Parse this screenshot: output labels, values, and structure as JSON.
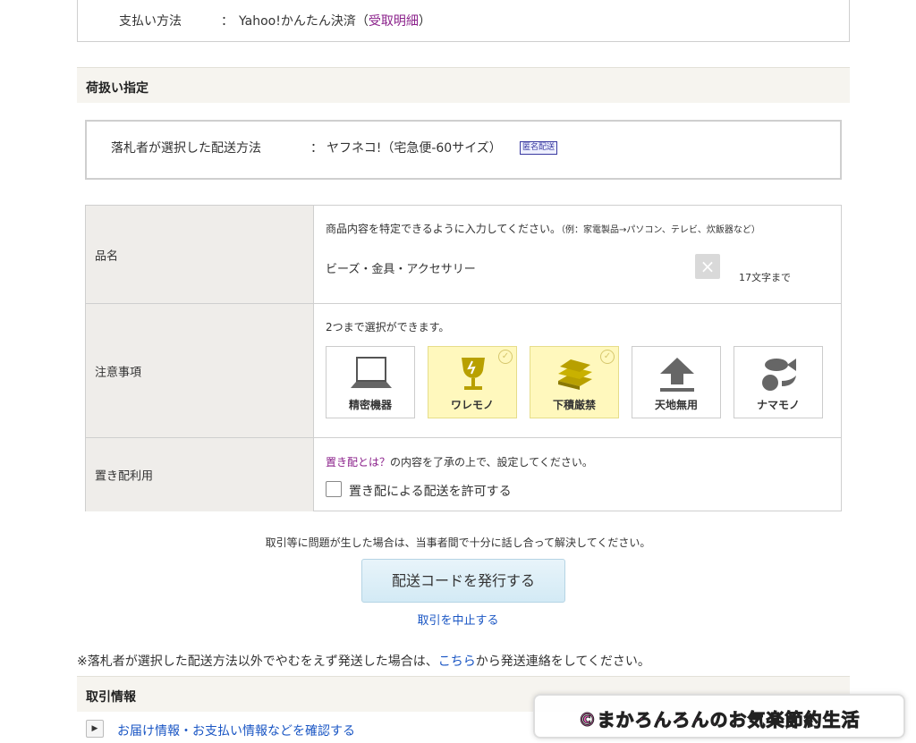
{
  "payment": {
    "label": "支払い方法",
    "colon": "：",
    "value": "Yahoo!かんたん決済",
    "paren_open": "（",
    "receipt_link": "受取明細",
    "paren_close": "）"
  },
  "handling_section": {
    "title": "荷扱い指定"
  },
  "shipping": {
    "label": "落札者が選択した配送方法",
    "colon": "：",
    "value": "ヤフネコ!（宅急便-60サイズ）",
    "badge": "匿名配送"
  },
  "item_name": {
    "header": "品名",
    "hint": "商品内容を特定できるように入力してください。",
    "example": "（例：家電製品→パソコン、テレビ、炊飯器など）",
    "value": "ビーズ・金具・アクセサリー",
    "clear_icon": "×",
    "max_length": "17文字まで"
  },
  "caution": {
    "header": "注意事項",
    "hint": "2つまで選択ができます。",
    "check_icon": "✓",
    "options": [
      {
        "label": "精密機器",
        "icon": "laptop-icon",
        "selected": false
      },
      {
        "label": "ワレモノ",
        "icon": "broken-glass-icon",
        "selected": true
      },
      {
        "label": "下積厳禁",
        "icon": "stacked-books-icon",
        "selected": true
      },
      {
        "label": "天地無用",
        "icon": "up-arrow-icon",
        "selected": false
      },
      {
        "label": "ナマモノ",
        "icon": "perishables-icon",
        "selected": false
      }
    ]
  },
  "okihai": {
    "header": "置き配利用",
    "hint_link": "置き配とは？",
    "hint_rest": "の内容を了承の上で、設定してください。",
    "checkbox_label": "置き配による配送を許可する",
    "checked": false
  },
  "notice": "取引等に問題が生した場合は、当事者間で十分に話し合って解決してください。",
  "issue_button": "配送コードを発行する",
  "cancel_link": "取引を中止する",
  "footnote": {
    "prefix": "※落札者が選択した配送方法以外でやむをえず発送した場合は、",
    "link": "こちら",
    "suffix": "から発送連絡をしてください。"
  },
  "trade_section": {
    "title": "取引情報"
  },
  "detail": {
    "play_icon": "▶",
    "link": "お届け情報・お支払い情報などを確認する"
  },
  "watermark": "©まかろんろんのお気楽節約生活",
  "colors": {
    "link": "#1a56c4",
    "purple_link": "#8a1f8a",
    "selected_bg": "#fff8bd",
    "section_bg": "#f6f4ef",
    "button_bg": "#d3eaf5"
  }
}
